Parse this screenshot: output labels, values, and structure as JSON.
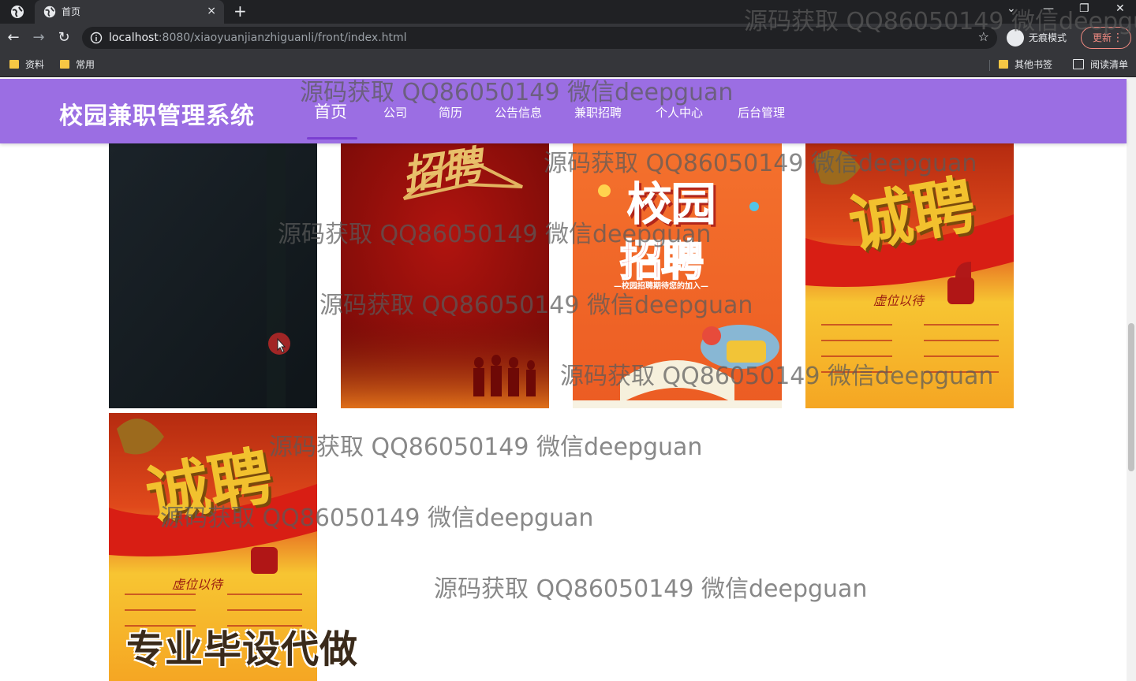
{
  "browser": {
    "tab_title": "首页",
    "tab_close": "×",
    "new_tab": "+",
    "url_host": "localhost",
    "url_rest": ":8080/xiaoyuanjianzhiguanli/front/index.html",
    "incognito_label": "无痕模式",
    "update_label": "更新",
    "bookmarks": [
      "资料",
      "常用"
    ],
    "other_bookmarks": "其他书签",
    "reading_list": "阅读清单"
  },
  "site": {
    "title": "校园兼职管理系统",
    "nav": [
      "首页",
      "公司",
      "简历",
      "公告信息",
      "兼职招聘",
      "个人中心",
      "后台管理"
    ],
    "active_nav": "首页"
  },
  "posters": [
    {
      "name": "dark-poster"
    },
    {
      "name": "recruit-red-poster",
      "text": "招聘"
    },
    {
      "name": "campus-recruit-poster",
      "text_top": "校园",
      "text_bottom": "招聘",
      "subtitle": "—校园招聘期待您的加入—"
    },
    {
      "name": "sincere-recruit-poster",
      "text": "诚聘",
      "subtitle": "虚位以待"
    },
    {
      "name": "sincere-recruit-poster-2",
      "text": "诚聘",
      "subtitle": "虚位以待"
    }
  ],
  "overlay": {
    "watermark": "源码获取 QQ86050149 微信deepguan",
    "promo": "专业毕设代做"
  },
  "colors": {
    "header": "#9b6ee3",
    "nav_underline": "#7b3fd1"
  }
}
